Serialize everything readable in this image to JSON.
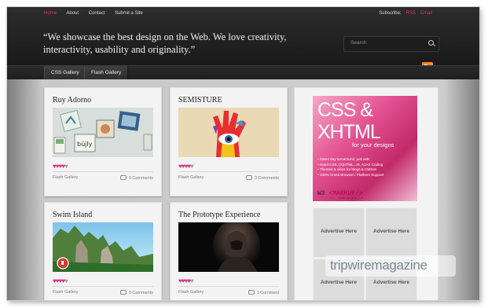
{
  "topnav": {
    "items": [
      "Home",
      "About",
      "Contact",
      "Submit a Site"
    ]
  },
  "subscribe": {
    "label": "Subscribe:",
    "rss": "RSS",
    "email": "Email"
  },
  "tagline": "“We showcase the best design on the Web.  We love creativity, interactivity, usability and originality.”",
  "search": {
    "placeholder": "Search"
  },
  "menu": {
    "items": [
      "CSS Gallery",
      "Flash Gallery"
    ]
  },
  "cards": [
    {
      "title": "Ruy Adorno",
      "category": "Flash Gallery",
      "comments": "0 Comments",
      "rating": 4
    },
    {
      "title": "SEMISTURE",
      "category": "Flash Gallery",
      "comments": "3 Comments",
      "rating": 4
    },
    {
      "title": "Swim Island",
      "category": "Flash Gallery",
      "comments": "0 Comments",
      "rating": 4
    },
    {
      "title": "The Prototype Experience",
      "category": "Flash Gallery",
      "comments": "1 Comment",
      "rating": 4
    }
  ],
  "sidebar": {
    "banner": {
      "line1": "CSS &",
      "line2": "XHTML",
      "line3": "for your designs",
      "features": [
        "Same day turnaround, just ask!",
        "Hand CSS, (X)HTML, JS, AJAX Coding",
        "Themes & skins for blogs & CMSes",
        "100% Cross Browser / Platform Support"
      ],
      "brand_prefix": "W3",
      "brand_markup": "<MARKUP/>",
      "brand_tagline": "<!-- code is art -->"
    },
    "ads": [
      "Advertise Here",
      "Advertise Here",
      "Advertise Here",
      "Advertise Here"
    ]
  },
  "watermark": "tripwiremagazine",
  "colors": {
    "accent": "#e0306a",
    "header": "#1c1c1c",
    "heart": "#d92a7d"
  }
}
